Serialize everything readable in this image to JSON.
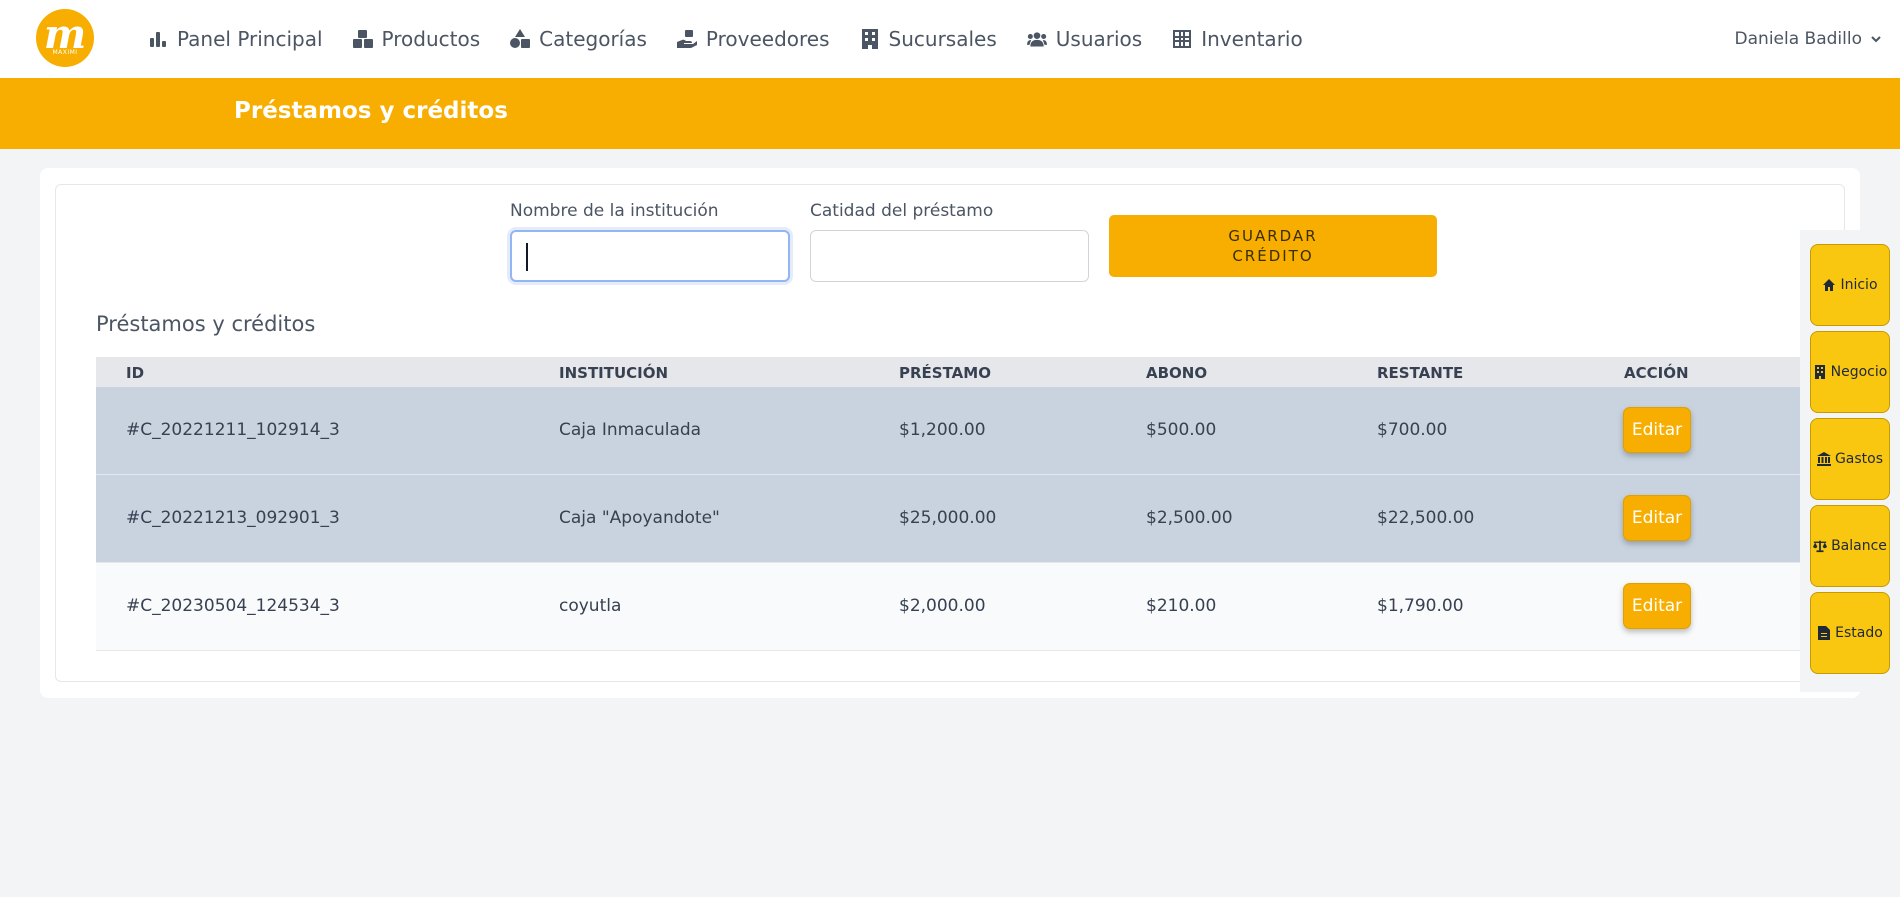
{
  "nav": {
    "logo_letter": "m",
    "logo_sub": "MAXIMI",
    "items": [
      {
        "label": "Panel Principal",
        "icon": "chart-bar-icon"
      },
      {
        "label": "Productos",
        "icon": "boxes-icon"
      },
      {
        "label": "Categorías",
        "icon": "shapes-icon"
      },
      {
        "label": "Proveedores",
        "icon": "hand-holding-icon"
      },
      {
        "label": "Sucursales",
        "icon": "building-icon"
      },
      {
        "label": "Usuarios",
        "icon": "users-icon"
      },
      {
        "label": "Inventario",
        "icon": "table-icon"
      }
    ],
    "user_name": "Daniela Badillo"
  },
  "header": {
    "title": "Préstamos y créditos"
  },
  "form": {
    "institution_label": "Nombre de la institución",
    "institution_value": "",
    "amount_label": "Catidad del préstamo",
    "amount_value": "",
    "save_line1": "GUARDAR",
    "save_line2": "CRÉDITO"
  },
  "table": {
    "title": "Préstamos y créditos",
    "headers": [
      "ID",
      "INSTITUCIÓN",
      "PRÉSTAMO",
      "ABONO",
      "RESTANTE",
      "ACCIÓN"
    ],
    "rows": [
      {
        "id": "#C_20221211_102914_3",
        "institution": "Caja Inmaculada",
        "loan": "$1,200.00",
        "payment": "$500.00",
        "remaining": "$700.00",
        "action": "Editar"
      },
      {
        "id": "#C_20221213_092901_3",
        "institution": "Caja \"Apoyandote\"",
        "loan": "$25,000.00",
        "payment": "$2,500.00",
        "remaining": "$22,500.00",
        "action": "Editar"
      },
      {
        "id": "#C_20230504_124534_3",
        "institution": "coyutla",
        "loan": "$2,000.00",
        "payment": "$210.00",
        "remaining": "$1,790.00",
        "action": "Editar"
      }
    ]
  },
  "dock": [
    {
      "label": "Inicio",
      "icon": "home-icon"
    },
    {
      "label": "Negocio",
      "icon": "building-icon"
    },
    {
      "label": "Gastos",
      "icon": "bank-icon"
    },
    {
      "label": "Balance",
      "icon": "scale-icon"
    },
    {
      "label": "Estado",
      "icon": "file-icon"
    }
  ],
  "colors": {
    "accent": "#f7ae00",
    "dock_button": "#fac710",
    "row_highlight": "#c8d3df"
  }
}
